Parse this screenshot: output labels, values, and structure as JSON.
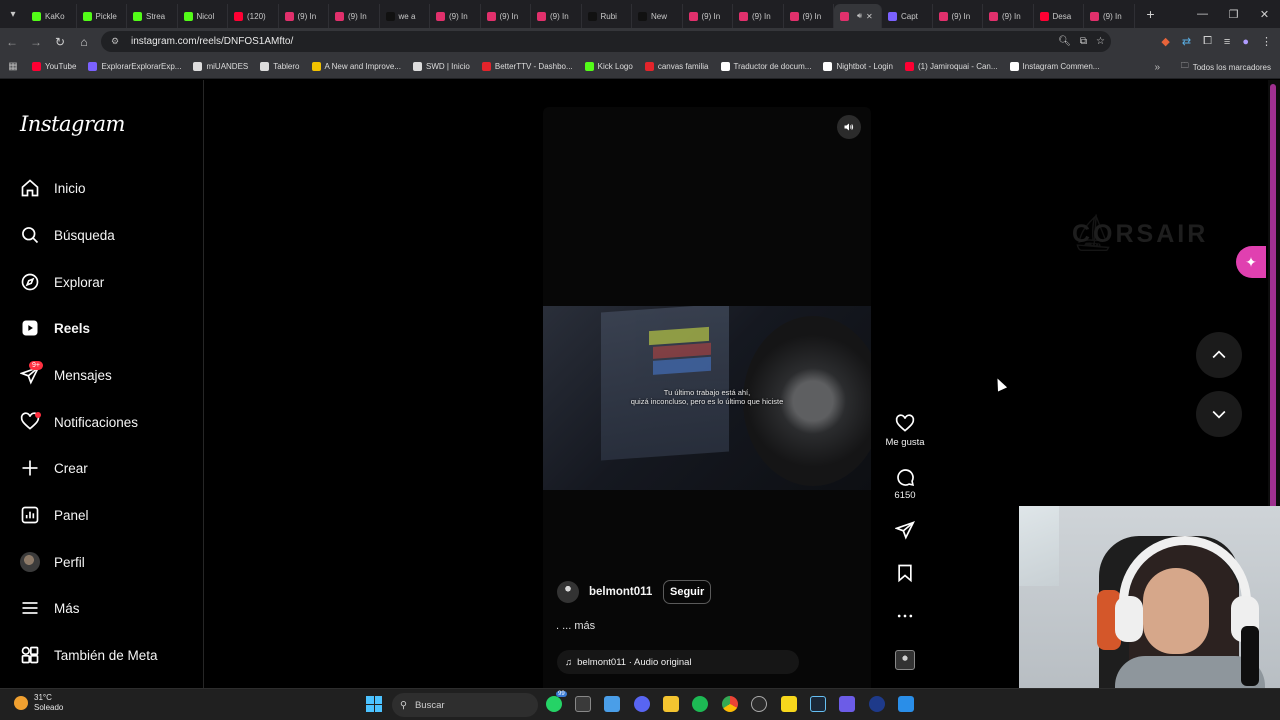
{
  "browser": {
    "tabs": [
      {
        "title": "KaKo",
        "color": "#53fc18"
      },
      {
        "title": "Pickle",
        "color": "#53fc18"
      },
      {
        "title": "Strea",
        "color": "#53fc18"
      },
      {
        "title": "Nicol",
        "color": "#53fc18"
      },
      {
        "title": "(120)",
        "color": "#ff0033"
      },
      {
        "title": "(9) In",
        "color": "#e1306c"
      },
      {
        "title": "(9) In",
        "color": "#e1306c"
      },
      {
        "title": "we a",
        "color": "#111111"
      },
      {
        "title": "(9) In",
        "color": "#e1306c"
      },
      {
        "title": "(9) In",
        "color": "#e1306c"
      },
      {
        "title": "(9) In",
        "color": "#e1306c"
      },
      {
        "title": "Rubi",
        "color": "#111111"
      },
      {
        "title": "New",
        "color": "#111111"
      },
      {
        "title": "(9) In",
        "color": "#e1306c"
      },
      {
        "title": "(9) In",
        "color": "#e1306c"
      },
      {
        "title": "(9) In",
        "color": "#e1306c"
      },
      {
        "title": "",
        "color": "#e1306c",
        "active": true
      },
      {
        "title": "Capt",
        "color": "#7b61ff"
      },
      {
        "title": "(9) In",
        "color": "#e1306c"
      },
      {
        "title": "(9) In",
        "color": "#e1306c"
      },
      {
        "title": "Desa",
        "color": "#ff0033"
      },
      {
        "title": "(9) In",
        "color": "#e1306c"
      }
    ],
    "url": "instagram.com/reels/DNFOS1AMfto/",
    "bookmarks": [
      {
        "label": "YouTube",
        "color": "#ff0033"
      },
      {
        "label": "ExplorarExplorarExp...",
        "color": "#7b61ff"
      },
      {
        "label": "miUANDES",
        "color": "#dddddd"
      },
      {
        "label": "Tablero",
        "color": "#dddddd"
      },
      {
        "label": "A New and Improve...",
        "color": "#f2c200"
      },
      {
        "label": "SWD | Inicio",
        "color": "#dddddd"
      },
      {
        "label": "BetterTTV - Dashbo...",
        "color": "#e3242b"
      },
      {
        "label": "Kick Logo",
        "color": "#53fc18"
      },
      {
        "label": "canvas familia",
        "color": "#e3242b"
      },
      {
        "label": "Traductor de docum...",
        "color": "#ffffff"
      },
      {
        "label": "Nightbot - Login",
        "color": "#ffffff"
      },
      {
        "label": "(1) Jamiroquai - Can...",
        "color": "#ff0033"
      },
      {
        "label": "Instagram Commen...",
        "color": "#ffffff"
      }
    ],
    "all_bookmarks": "Todos los marcadores"
  },
  "instagram": {
    "logo": "Instagram",
    "nav": {
      "home": "Inicio",
      "search": "Búsqueda",
      "explore": "Explorar",
      "reels": "Reels",
      "messages": "Mensajes",
      "messages_badge": "9+",
      "notifications": "Notificaciones",
      "create": "Crear",
      "panel": "Panel",
      "profile": "Perfil",
      "more": "Más",
      "meta": "También de Meta"
    },
    "reel": {
      "subtitle_line1": "Tu último trabajo está ahí,",
      "subtitle_line2": "quizá inconcluso, pero es lo último que hiciste",
      "author": "belmont011",
      "follow": "Seguir",
      "caption": ". ... más",
      "audio": "belmont011 · Audio original"
    },
    "actions": {
      "like": "Me gusta",
      "comments": "6150"
    },
    "sponsor_text": "CORSAIR"
  },
  "taskbar": {
    "temp": "31°C",
    "weather": "Soleado",
    "search": "Buscar",
    "badge_whatsapp": "99"
  }
}
